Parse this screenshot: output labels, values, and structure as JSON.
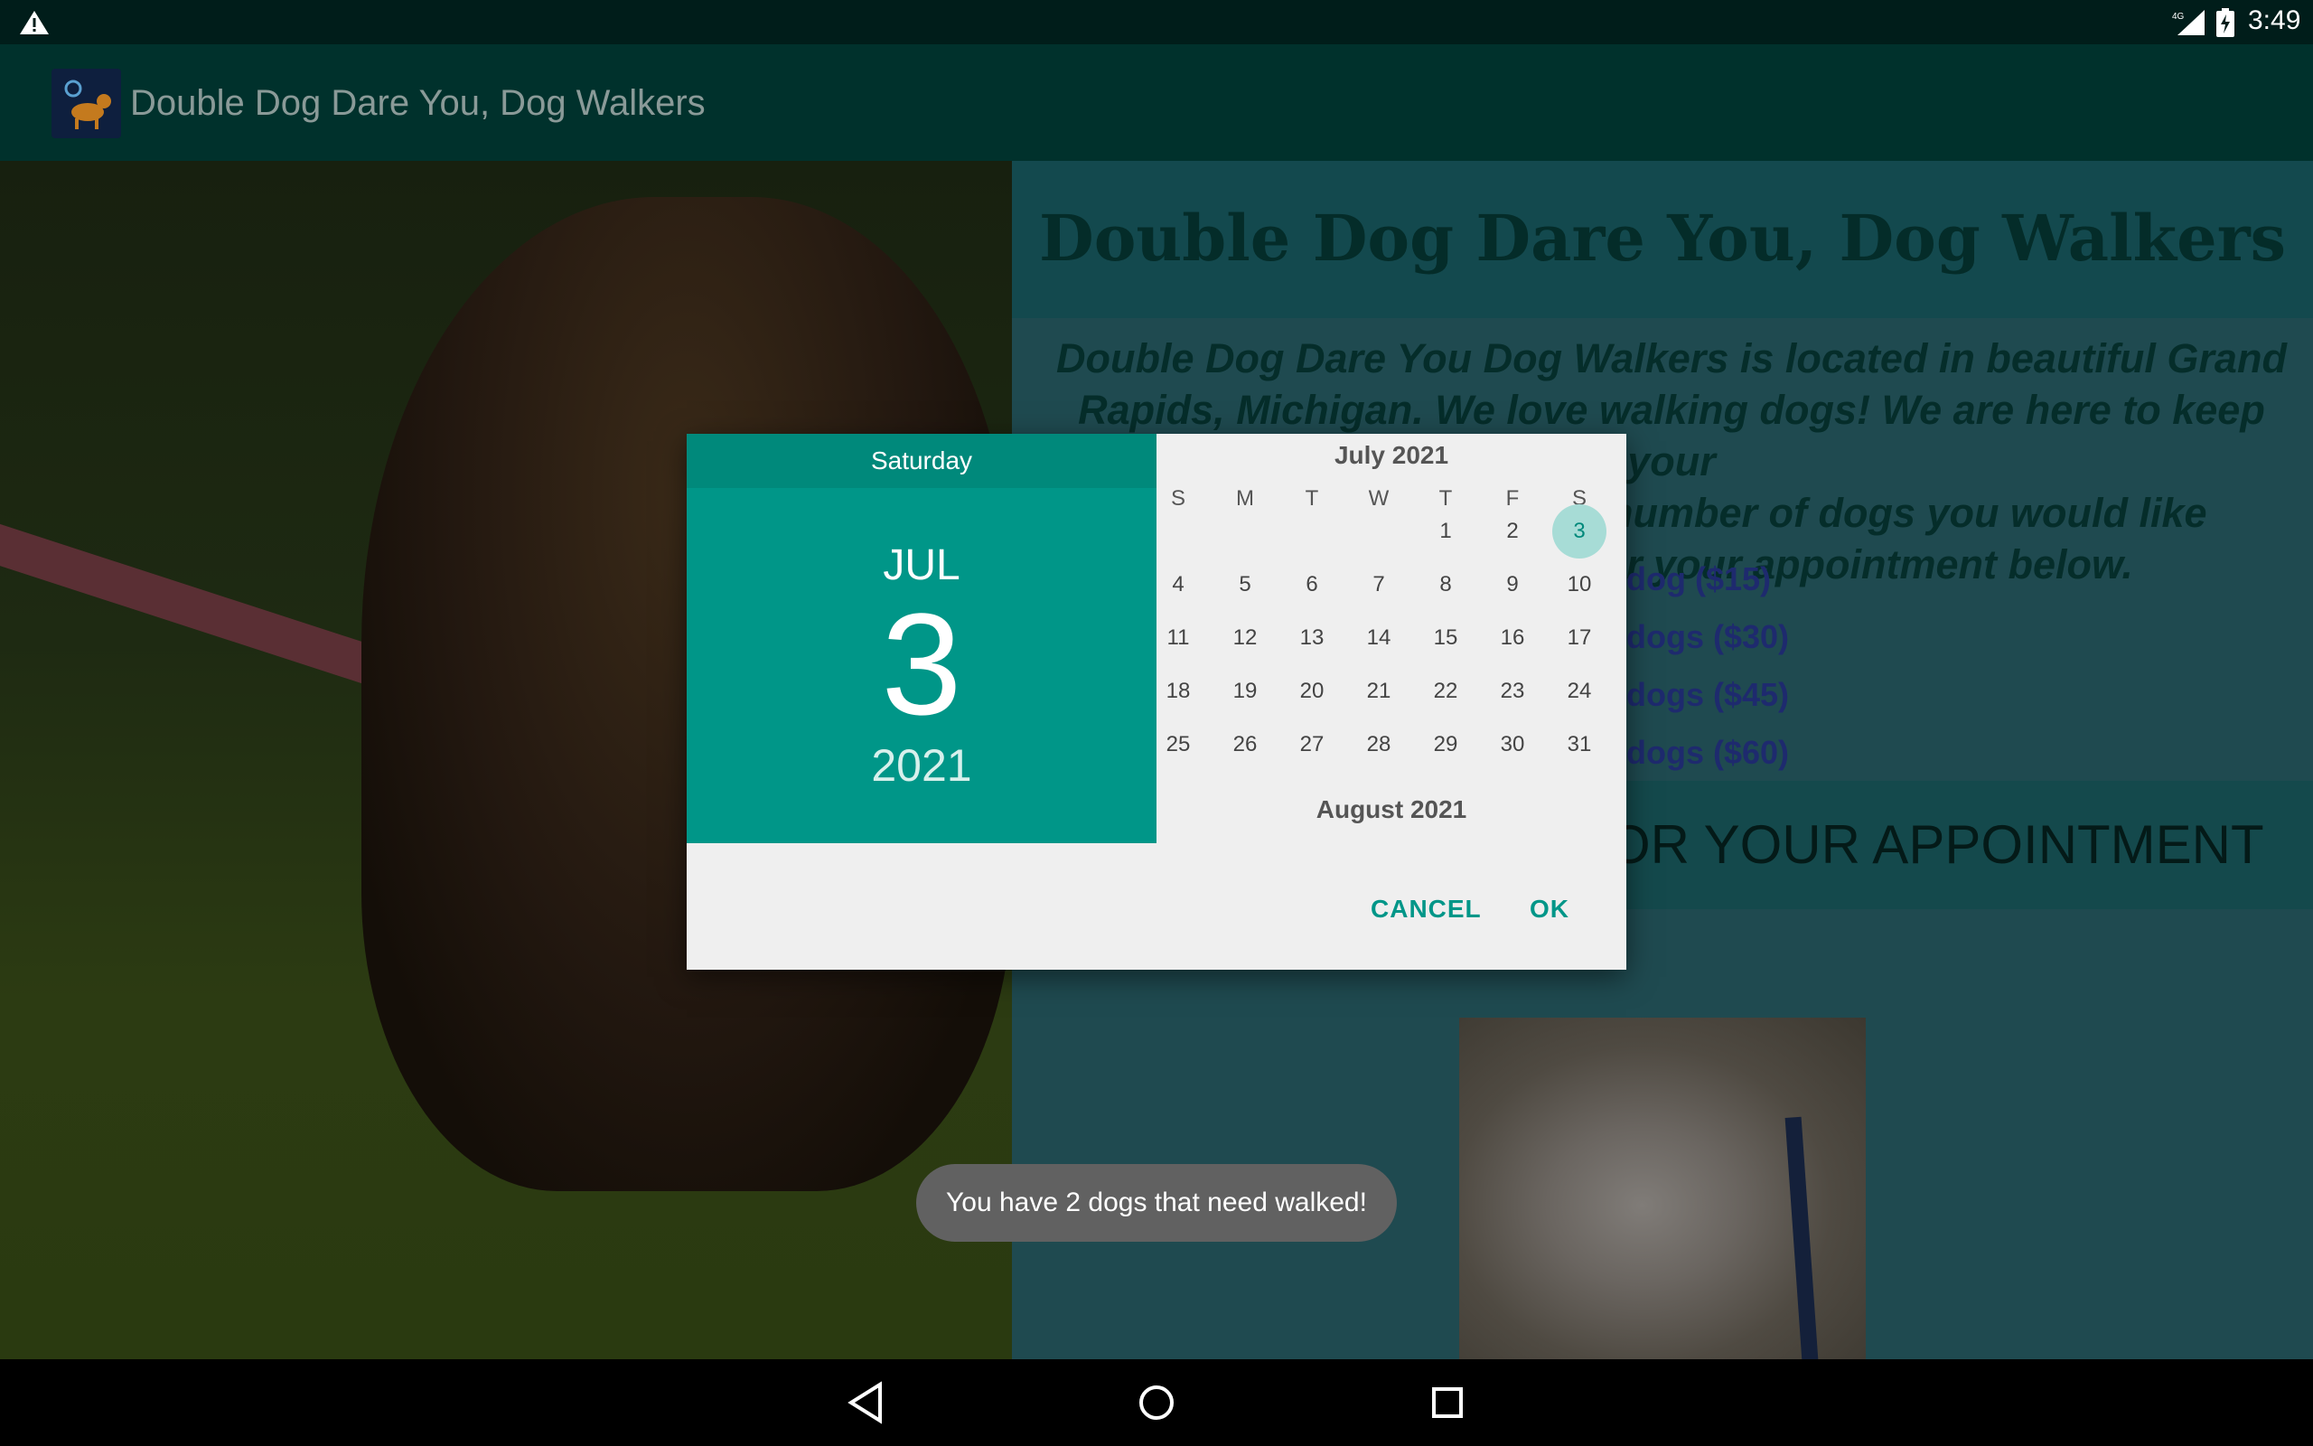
{
  "status_bar": {
    "time": "3:49",
    "network": "4G"
  },
  "app_bar": {
    "title": "Double Dog Dare You, Dog Walkers"
  },
  "page": {
    "heading": "Double Dog Dare You, Dog Walkers",
    "intro_lines": [
      "Double Dog Dare You Dog Walkers is located in beautiful Grand",
      "Rapids, Michigan. We love walking dogs! We are here to keep your",
      "the number of dogs you would like",
      "e for your appointment below."
    ],
    "options": [
      "dog ($15)",
      "dogs ($30)",
      "dogs ($45)",
      "dogs ($60)"
    ],
    "appointment_bar": "OR YOUR APPOINTMENT"
  },
  "date_picker": {
    "weekday": "Saturday",
    "month_abbr": "JUL",
    "day": "3",
    "year": "2021",
    "month_title": "July 2021",
    "next_month_title": "August 2021",
    "weekday_headers": [
      "S",
      "M",
      "T",
      "W",
      "T",
      "F",
      "S"
    ],
    "days": [
      "1",
      "2",
      "3",
      "4",
      "5",
      "6",
      "7",
      "8",
      "9",
      "10",
      "11",
      "12",
      "13",
      "14",
      "15",
      "16",
      "17",
      "18",
      "19",
      "20",
      "21",
      "22",
      "23",
      "24",
      "25",
      "26",
      "27",
      "28",
      "29",
      "30",
      "31"
    ],
    "selected_day": "3",
    "cancel_label": "CANCEL",
    "ok_label": "OK"
  },
  "toast": {
    "message": "You have 2 dogs that need walked!"
  },
  "colors": {
    "accent": "#009688",
    "header": "#00897b",
    "app_bar": "#00312c"
  }
}
